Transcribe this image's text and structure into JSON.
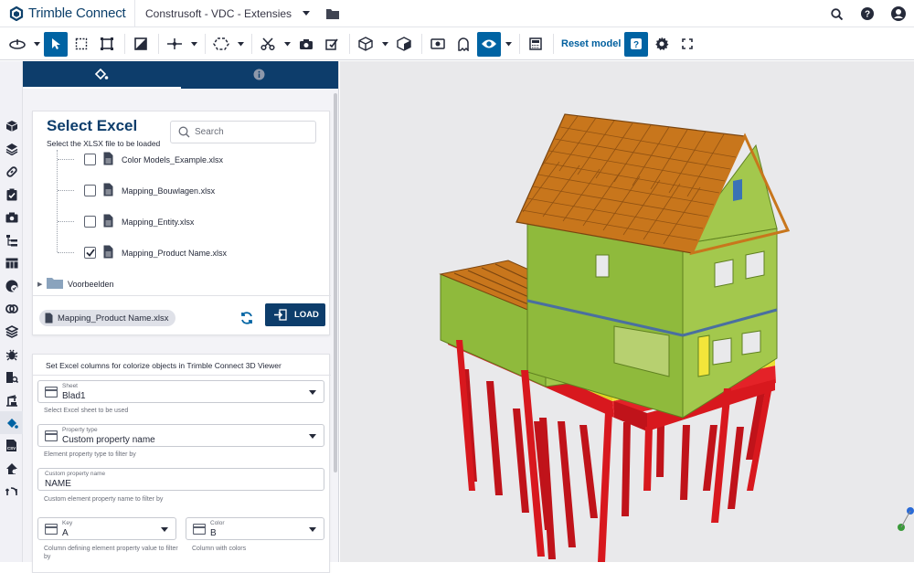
{
  "topbar": {
    "app_name": "Trimble Connect",
    "project_name": "Construsoft - VDC - Extensies",
    "icons": [
      "search-icon",
      "help-icon",
      "user-avatar-icon"
    ]
  },
  "toolbar": {
    "reset_model_label": "Reset model",
    "icons": [
      "orbit-icon",
      "select-icon",
      "box-select-icon",
      "fit-icon",
      "clip-icon",
      "measure-icon",
      "markup-icon",
      "cut-icon",
      "camera-icon",
      "clash-icon",
      "cube-icon",
      "view-icon",
      "snapshot-icon",
      "ghost-icon",
      "visibility-icon",
      "calculator-icon",
      "help-icon",
      "settings-icon",
      "fullscreen-icon"
    ],
    "active_tools": [
      "select",
      "visibility",
      "help"
    ]
  },
  "panel": {
    "tabs": [
      "paint-bucket-tab",
      "info-tab"
    ],
    "select_excel": {
      "title": "Select Excel",
      "subtitle": "Select the XLSX file to be loaded",
      "search_placeholder": "Search",
      "files": [
        {
          "name": "Color Models_Example.xlsx",
          "checked": false
        },
        {
          "name": "Mapping_Bouwlagen.xlsx",
          "checked": false
        },
        {
          "name": "Mapping_Entity.xlsx",
          "checked": false
        },
        {
          "name": "Mapping_Product Name.xlsx",
          "checked": true
        }
      ],
      "folder": "Voorbeelden",
      "selected_chip": "Mapping_Product Name.xlsx",
      "load_label": "LOAD"
    },
    "settings": {
      "header": "Set Excel columns for colorize objects in Trimble Connect 3D Viewer",
      "sheet": {
        "label": "Sheet",
        "value": "Blad1",
        "help": "Select Excel sheet to be used"
      },
      "property_type": {
        "label": "Property type",
        "value": "Custom property name",
        "help": "Element property type to filter by"
      },
      "custom_property": {
        "label": "Custom property name",
        "value": "NAME",
        "help": "Custom element property name to filter by"
      },
      "key": {
        "label": "Key",
        "value": "A",
        "help": "Column defining element property value to filter by"
      },
      "color": {
        "label": "Color",
        "value": "B",
        "help": "Column with colors"
      }
    }
  },
  "colors": {
    "brand_navy": "#0d3d6b",
    "accent_blue": "#0063a3",
    "model_green": "#8fba3c",
    "model_red": "#d8181e",
    "roof_orange": "#c8761c"
  }
}
